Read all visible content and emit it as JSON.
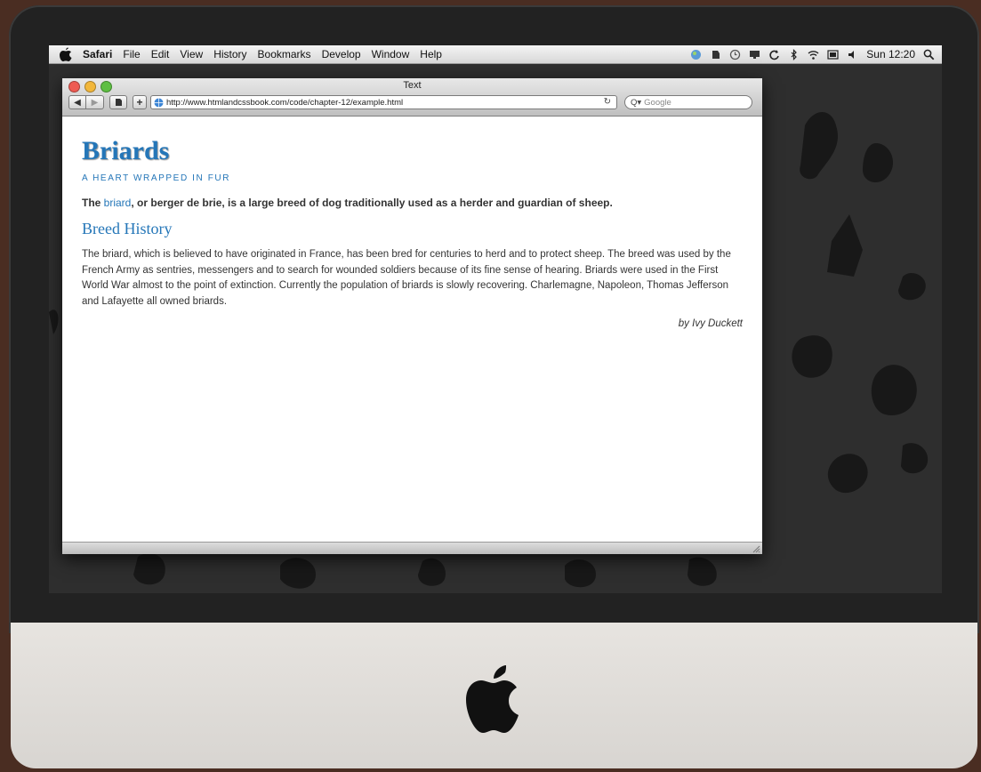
{
  "menubar": {
    "app": "Safari",
    "items": [
      "File",
      "Edit",
      "View",
      "History",
      "Bookmarks",
      "Develop",
      "Window",
      "Help"
    ],
    "clock": "Sun 12:20"
  },
  "window": {
    "title": "Text",
    "url": "http://www.htmlandcssbook.com/code/chapter-12/example.html",
    "search_placeholder": "Google"
  },
  "page": {
    "heading": "Briards",
    "subheading": "A HEART WRAPPED IN FUR",
    "intro_prefix": "The ",
    "intro_link": "briard",
    "intro_suffix": ", or berger de brie, is a large breed of dog traditionally used as a herder and guardian of sheep.",
    "section_title": "Breed History",
    "paragraph": "The briard, which is believed to have originated in France, has been bred for centuries to herd and to protect sheep. The breed was used by the French Army as sentries, messengers and to search for wounded soldiers because of its fine sense of hearing. Briards were used in the First World War almost to the point of extinction. Currently the population of briards is slowly recovering. Charlemagne, Napoleon, Thomas Jefferson and Lafayette all owned briards.",
    "byline": "by Ivy Duckett"
  },
  "colors": {
    "heading_blue": "#2476b8",
    "bezel": "#222222",
    "chin": "#e0ddd9"
  }
}
